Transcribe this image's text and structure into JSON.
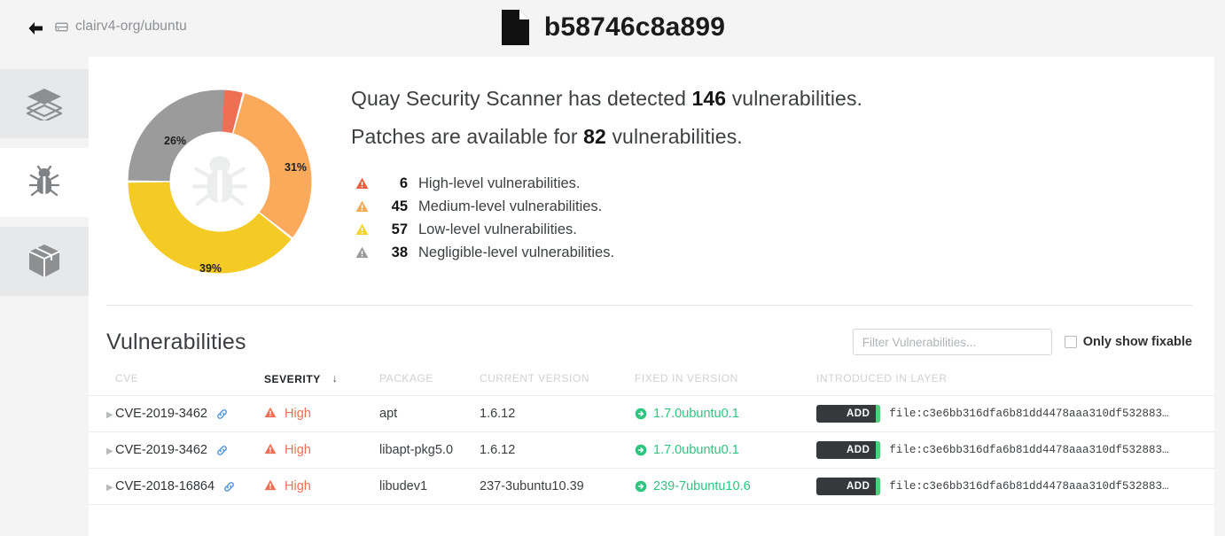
{
  "header": {
    "back_icon": "arrow-left-icon",
    "repo_icon": "repository-icon",
    "breadcrumb": "clairv4-org/ubuntu",
    "file_icon": "file-icon",
    "title": "b58746c8a899"
  },
  "sidebar": {
    "items": [
      {
        "icon": "layers-icon",
        "name": "image-layers",
        "active": false
      },
      {
        "icon": "bug-icon",
        "name": "security-scan",
        "active": true
      },
      {
        "icon": "package-icon",
        "name": "packages",
        "active": false
      }
    ]
  },
  "summary": {
    "detected_prefix": "Quay Security Scanner has detected",
    "detected_count": "146",
    "detected_suffix": "vulnerabilities.",
    "patches_prefix": "Patches are available for",
    "patches_count": "82",
    "patches_suffix": "vulnerabilities.",
    "severities": [
      {
        "count": "6",
        "label": "High-level vulnerabilities.",
        "color": "#e8603c",
        "icon": "warning-triangle-icon"
      },
      {
        "count": "45",
        "label": "Medium-level vulnerabilities.",
        "color": "#f0ab55",
        "icon": "warning-triangle-icon"
      },
      {
        "count": "57",
        "label": "Low-level vulnerabilities.",
        "color": "#f5d328",
        "icon": "warning-triangle-icon"
      },
      {
        "count": "38",
        "label": "Negligible-level vulnerabilities.",
        "color": "#9b9b9b",
        "icon": "warning-triangle-icon"
      }
    ]
  },
  "chart_data": {
    "type": "pie",
    "title": "",
    "categories": [
      "High",
      "Medium",
      "Low",
      "Negligible"
    ],
    "values": [
      4,
      31,
      39,
      26
    ],
    "labels": [
      "",
      "31%",
      "39%",
      "26%"
    ],
    "colors": [
      "#ef6f54",
      "#fba95b",
      "#f3cb24",
      "#9b9b9b"
    ],
    "donut": true,
    "legend": "none",
    "center_icon": "bug-icon"
  },
  "vulnerabilities": {
    "title": "Vulnerabilities",
    "filter_placeholder": "Filter Vulnerabilities...",
    "filter_value": "",
    "fixable_label": "Only show fixable",
    "fixable_checked": false,
    "columns": {
      "cve": "CVE",
      "severity": "SEVERITY",
      "package": "PACKAGE",
      "current_version": "CURRENT VERSION",
      "fixed_in_version": "FIXED IN VERSION",
      "introduced_in_layer": "INTRODUCED IN LAYER"
    },
    "sort_column": "SEVERITY",
    "sort_direction": "desc",
    "sort_icon": "arrow-down-icon",
    "rows": [
      {
        "cve": "CVE-2019-3462",
        "severity": "High",
        "package": "apt",
        "current_version": "1.6.12",
        "fixed_in_version": "1.7.0ubuntu0.1",
        "layer_badge": "ADD",
        "layer": "file:c3e6bb316dfa6b81dd4478aaa310df532883…"
      },
      {
        "cve": "CVE-2019-3462",
        "severity": "High",
        "package": "libapt-pkg5.0",
        "current_version": "1.6.12",
        "fixed_in_version": "1.7.0ubuntu0.1",
        "layer_badge": "ADD",
        "layer": "file:c3e6bb316dfa6b81dd4478aaa310df532883…"
      },
      {
        "cve": "CVE-2018-16864",
        "severity": "High",
        "package": "libudev1",
        "current_version": "237-3ubuntu10.39",
        "fixed_in_version": "239-7ubuntu10.6",
        "layer_badge": "ADD",
        "layer": "file:c3e6bb316dfa6b81dd4478aaa310df532883…"
      }
    ]
  }
}
